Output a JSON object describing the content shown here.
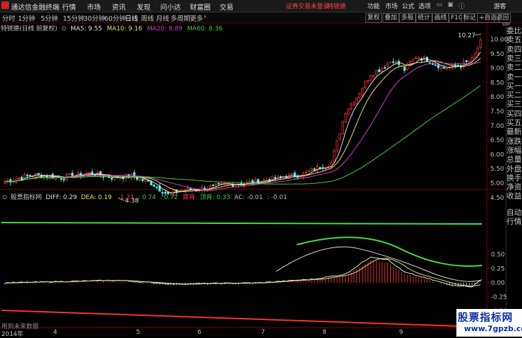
{
  "window": {
    "app_title": "通达信金融终端",
    "menu": [
      "行情",
      "市场",
      "资讯",
      "发现",
      "问小达",
      "财富圈",
      "交易"
    ],
    "login_status": "证券交易未登录",
    "stock_link": "特锐德",
    "sys_menu": [
      "功能",
      "市场",
      "公式",
      "选项"
    ],
    "guest": "游客"
  },
  "toolbar": {
    "periods": [
      "分时",
      "1分钟",
      "5分钟",
      "15分钟",
      "30分钟",
      "60分钟",
      "日线",
      "周线",
      "月线",
      "多周期",
      "更多"
    ],
    "active_period": "日线",
    "more_suffix": "›",
    "buttons": [
      "复权",
      "叠加",
      "多股",
      "统计",
      "画线",
      "F10",
      "标记",
      "+自选",
      "返回"
    ]
  },
  "chart": {
    "stock_title": "特锐德(日线 前复权)",
    "ma": [
      {
        "label": "MA5: 9.55",
        "color": "#e0e0e0"
      },
      {
        "label": "MA10: 9.16",
        "color": "#e8e070"
      },
      {
        "label": "MA20: 8.89",
        "color": "#d040d0"
      },
      {
        "label": "MA60: 8.36",
        "color": "#40d040"
      }
    ],
    "high_mark": "10.27",
    "low_mark": "4.38",
    "y_ticks": [
      "10.00",
      "9.50",
      "9.00",
      "8.50",
      "8.00",
      "7.50",
      "7.00",
      "6.50",
      "6.00",
      "5.50",
      "5.00",
      "4.50"
    ],
    "top_scale": "500",
    "colors": {
      "up": "#ff3232",
      "down": "#54fcfc",
      "ma5": "#e0e0e0",
      "ma10": "#e8e070",
      "ma20": "#d040d0",
      "ma60": "#40d040"
    }
  },
  "indicator": {
    "name": "股票指标网",
    "items": [
      {
        "label": "DIFF: 0.29",
        "color": "#e0e0e0"
      },
      {
        "label": "DEA: 0.19",
        "color": "#e8e070"
      },
      {
        "label": "-1.21",
        "color": "#ff4040"
      },
      {
        "label": ": 0.74",
        "color": "#40d040"
      },
      {
        "label": ": 0.72",
        "color": "#40d040"
      },
      {
        "label": "底背",
        "color": "#ff4040"
      },
      {
        "label": "顶背: 0.33",
        "color": "#40d040"
      },
      {
        "label": "AC: -0.01",
        "color": "#c0c0c0"
      },
      {
        "label": ": -0.01",
        "color": "#c0c0c0"
      }
    ],
    "y_ticks": [
      "0.50",
      "0.25",
      "0.00",
      "-0.25",
      "-0.50"
    ]
  },
  "right_panel": {
    "top_labels": [
      "委比",
      "卖五",
      "卖四",
      "卖三",
      "卖二",
      "卖一",
      "买一",
      "买二",
      "买三",
      "买四",
      "买五",
      "最新",
      "涨跌",
      "涨幅",
      "总量",
      "外盘",
      "换手",
      "净资",
      "收益"
    ],
    "bottom_labels": [
      "自动",
      "行情"
    ]
  },
  "x_axis": {
    "year": "2014年",
    "months": [
      "4",
      "5",
      "6",
      "7",
      "8",
      "9"
    ]
  },
  "footer_tip": "用到未来数据",
  "watermark": {
    "line1": "股票指标网",
    "line2": "www.7gpzb.com"
  }
}
